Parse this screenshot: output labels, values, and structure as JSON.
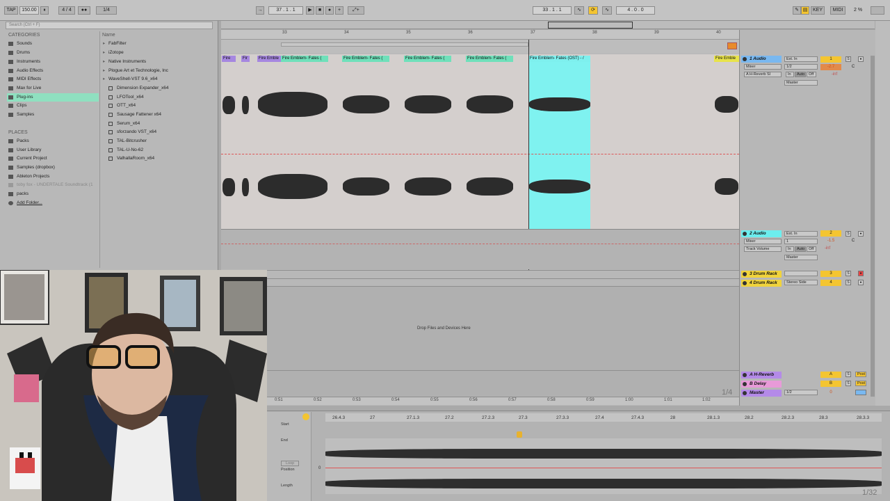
{
  "control_bar": {
    "tap": "TAP",
    "tempo": "150.00",
    "time_sig": "4 / 4",
    "quantize": "1/4",
    "position": "37 . 1 . 1",
    "loop_start": "33 . 1 . 1",
    "loop_length": "4 . 0 . 0",
    "key_label": "KEY",
    "midi_label": "MIDI",
    "cpu": "2 %"
  },
  "browser": {
    "search_placeholder": "Search (Ctrl + F)",
    "categories_header": "CATEGORIES",
    "name_header": "Name",
    "categories": [
      "Sounds",
      "Drums",
      "Instruments",
      "Audio Effects",
      "MIDI Effects",
      "Max for Live",
      "Plug-ins",
      "Clips",
      "Samples"
    ],
    "selected_category": "Plug-ins",
    "places_header": "PLACES",
    "places": [
      "Packs",
      "User Library",
      "Current Project",
      "Samples (dropbox)",
      "Ableton Projects",
      "toby fox - UNDERTALE Soundtrack (1",
      "packs",
      "Add Folder..."
    ],
    "names": [
      "FabFilter",
      "iZotope",
      "Native Instruments",
      "Plogue Art et Technologie, Inc",
      "WaveShell-VST 9.6_x64"
    ],
    "plugins": [
      "Dimension Expander_x64",
      "LFOTool_x64",
      "OTT_x64",
      "Sausage Fattener x64",
      "Serum_x64",
      "sforzando VST_x64",
      "TAL-Bitcrusher",
      "TAL-U-No-62",
      "ValhallaRoom_x64"
    ]
  },
  "arrangement": {
    "ruler": [
      "33",
      "34",
      "35",
      "36",
      "37",
      "38",
      "39",
      "40"
    ],
    "clips": [
      "Fire",
      "Fir",
      "Fire Emble",
      "Fire Emblem- Fates (",
      "Fire Emblem- Fates (",
      "Fire Emblem- Fates (",
      "Fire Emblem- Fates (",
      "Fire Emblem- Fates (OST) - /",
      "Fire Emble"
    ],
    "drop_text": "Drop Files and Devices Here",
    "times": [
      "0:51",
      "0:52",
      "0:53",
      "0:54",
      "0:55",
      "0:56",
      "0:57",
      "0:58",
      "0:59",
      "1:00",
      "1:01",
      "1:02"
    ],
    "zoom": "1/4"
  },
  "mixer": {
    "tracks": [
      {
        "name": "1 Audio",
        "input": "Ext. In",
        "channel": "1/2",
        "sub": "Mixer",
        "device": "A H-Reverb Sl",
        "out": "Master",
        "num": "1",
        "vol": "-2.7",
        "pan": "C",
        "send": "-inf"
      },
      {
        "name": "2 Audio",
        "input": "Ext. In",
        "channel": "1",
        "sub": "Mixer",
        "device": "Track Volume",
        "out": "Master",
        "num": "2",
        "vol": "-1.5",
        "pan": "C",
        "send": "-inf"
      },
      {
        "name": "3 Drum Rack",
        "input": "",
        "num": "3"
      },
      {
        "name": "4 Drum Rack",
        "input": "Stereo Side",
        "num": "4"
      }
    ],
    "monitor": [
      "In",
      "Auto",
      "Off"
    ],
    "returns": [
      {
        "name": "A H-Reverb",
        "letter": "A"
      },
      {
        "name": "B Delay",
        "letter": "B"
      },
      {
        "name": "Master",
        "letter": "0",
        "out": "1/2"
      }
    ],
    "solo": "S",
    "post": "Post"
  },
  "detail": {
    "start": "Start",
    "end": "End",
    "loop": "Loop",
    "position": "Position",
    "length": "Length",
    "ruler": [
      "26.4.3",
      "27",
      "27.1.3",
      "27.2",
      "27.2.3",
      "27.3",
      "27.3.3",
      "27.4",
      "27.4.3",
      "28",
      "28.1.3",
      "28.2",
      "28.2.3",
      "28.3",
      "28.3.3"
    ],
    "zero": "0",
    "zoom": "1/32"
  },
  "colors": {
    "clip_green": "#6fe0ba",
    "clip_selected": "#7ff2f0",
    "track_blue": "#79b8f0",
    "track_yellow": "#f0d33c",
    "return_purple": "#b48ae8",
    "return_pink": "#e89ad8",
    "accent_orange": "#f4c531"
  }
}
